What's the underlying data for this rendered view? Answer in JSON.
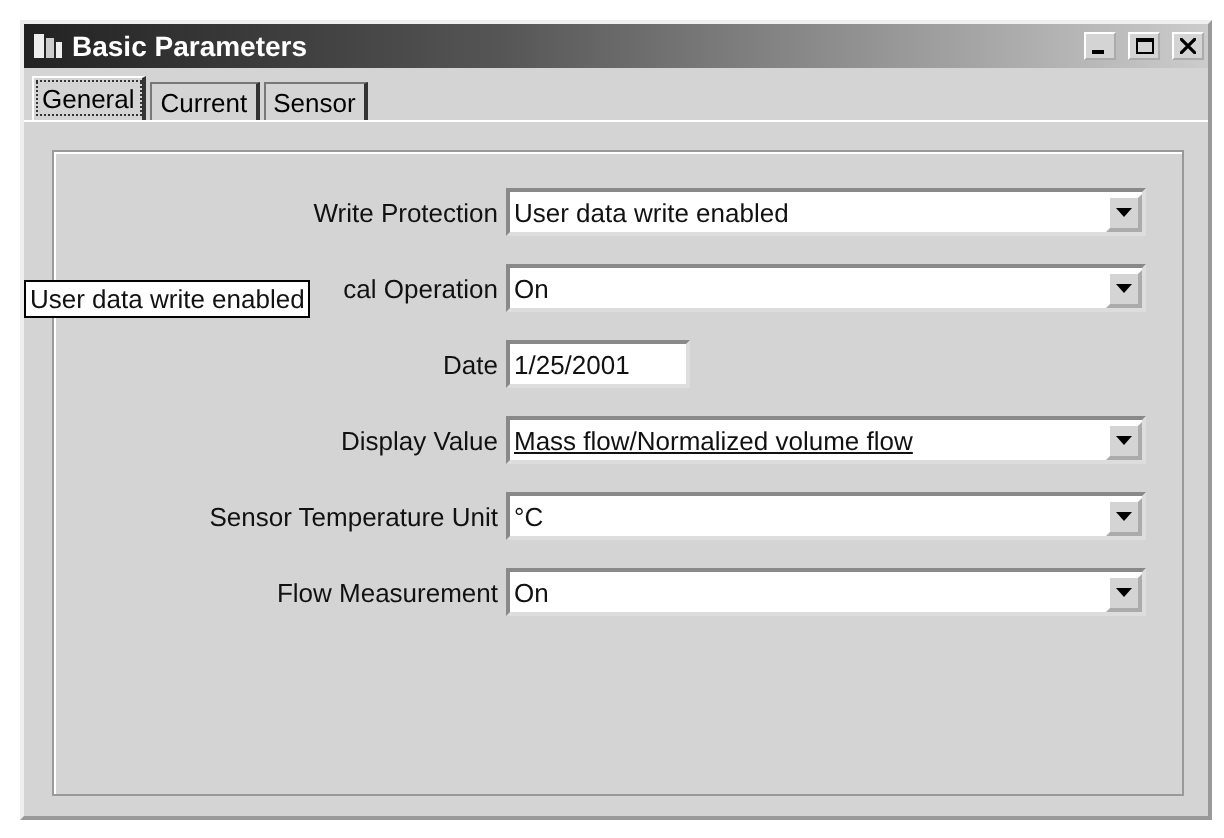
{
  "window": {
    "title": "Basic Parameters"
  },
  "tabs": [
    {
      "label": "General",
      "selected": true
    },
    {
      "label": "Current",
      "selected": false
    },
    {
      "label": "Sensor",
      "selected": false
    }
  ],
  "fields": [
    {
      "label": "Write Protection",
      "kind": "dropdown",
      "value": "User data write enabled",
      "focused": false
    },
    {
      "label": "cal Operation",
      "kind": "dropdown",
      "value": "On",
      "focused": false
    },
    {
      "label": "Date",
      "kind": "text",
      "value": "1/25/2001",
      "focused": false
    },
    {
      "label": "Display Value",
      "kind": "dropdown",
      "value": "Mass flow/Normalized volume flow",
      "focused": true
    },
    {
      "label": "Sensor Temperature Unit",
      "kind": "dropdown",
      "value": "°C",
      "focused": false
    },
    {
      "label": "Flow Measurement",
      "kind": "dropdown",
      "value": "On",
      "focused": false
    }
  ],
  "tooltip": "User data write enabled"
}
